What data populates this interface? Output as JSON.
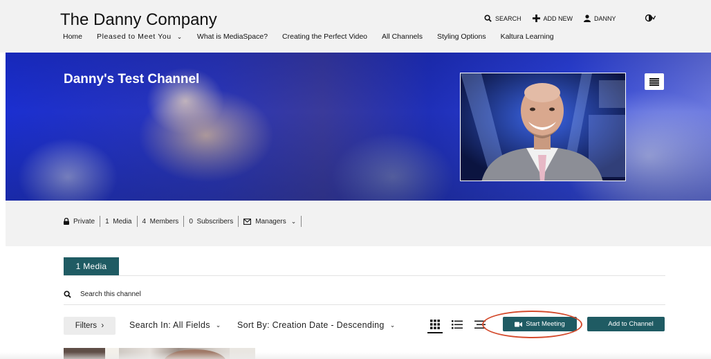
{
  "header": {
    "site_title": "The Danny Company",
    "nav": [
      {
        "label": "Home"
      },
      {
        "label": "Pleased to Meet You",
        "has_dropdown": true
      },
      {
        "label": "What is MediaSpace?"
      },
      {
        "label": "Creating the Perfect Video"
      },
      {
        "label": "All Channels"
      },
      {
        "label": "Styling Options"
      },
      {
        "label": "Kaltura Learning"
      }
    ],
    "search_label": "SEARCH",
    "add_new_label": "ADD NEW",
    "user_label": "DANNY",
    "contrast_icon": "contrast-toggle-icon"
  },
  "channel": {
    "title": "Danny's Test Channel",
    "banner_colors": {
      "primary": "#1b2fd0",
      "accent": "#2d43d8"
    },
    "menu_icon": "menu-icon"
  },
  "meta": {
    "privacy": "Private",
    "media_count": "1",
    "media_label": "Media",
    "members_count": "4",
    "members_label": "Members",
    "subscribers_count": "0",
    "subscribers_label": "Subscribers",
    "managers_label": "Managers"
  },
  "tabs": [
    {
      "label": "1 Media",
      "active": true
    }
  ],
  "search": {
    "placeholder": "Search this channel"
  },
  "controls": {
    "filters_label": "Filters",
    "search_in_label": "Search In: All Fields",
    "sort_by_label": "Sort By: Creation Date - Descending",
    "view_modes": [
      "grid-view-icon",
      "list-view-icon",
      "detailed-view-icon"
    ],
    "active_view": "grid",
    "start_meeting_label": "Start Meeting",
    "add_to_channel_label": "Add to Channel",
    "accent_color": "#1f5b63",
    "highlight_color": "#d44b2d"
  }
}
